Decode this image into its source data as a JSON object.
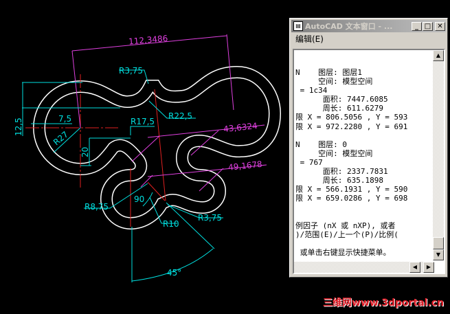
{
  "drawing": {
    "dims": {
      "d1": "112,3486",
      "d2": "R3,75",
      "d3": "R22,5",
      "d4": "7,5",
      "d5": "12,5",
      "d6": "R27",
      "d7": "R17,5",
      "d8": "20",
      "d9": "43,6324",
      "d10": "49,1678",
      "d11": "R8,75",
      "d12": "90",
      "d13": "R10",
      "d14": "R3,75",
      "d15": "45°"
    },
    "colors": {
      "background": "#000000",
      "geometry": "#ffffff",
      "dimension": "#00e0e0",
      "measure": "#e040e0",
      "centerline": "#e02020"
    }
  },
  "text_window": {
    "title": "AutoCAD 文本窗口 - ...",
    "menu": "编辑(E)",
    "lines": [
      "N    图层: 图层1",
      "     空间: 模型空间",
      " = 1c34",
      "      面积: 7447.6085",
      "      周长: 611.6279",
      "限 X = 806.5056 , Y = 593",
      "限 X = 972.2280 , Y = 691",
      "",
      "N    图层: 0",
      "     空间: 模型空间",
      " = 767",
      "      面积: 2337.7831",
      "      周长: 635.1898",
      "限 X = 566.1931 , Y = 590",
      "限 X = 659.0286 , Y = 698",
      "",
      "",
      "例因子 (nX 或 nXP), 或者",
      ")/范围(E)/上一个(P)/比例(",
      "",
      " 或单击右键显示快捷菜单。"
    ]
  },
  "watermark": "三维网www.3dportal.cn"
}
